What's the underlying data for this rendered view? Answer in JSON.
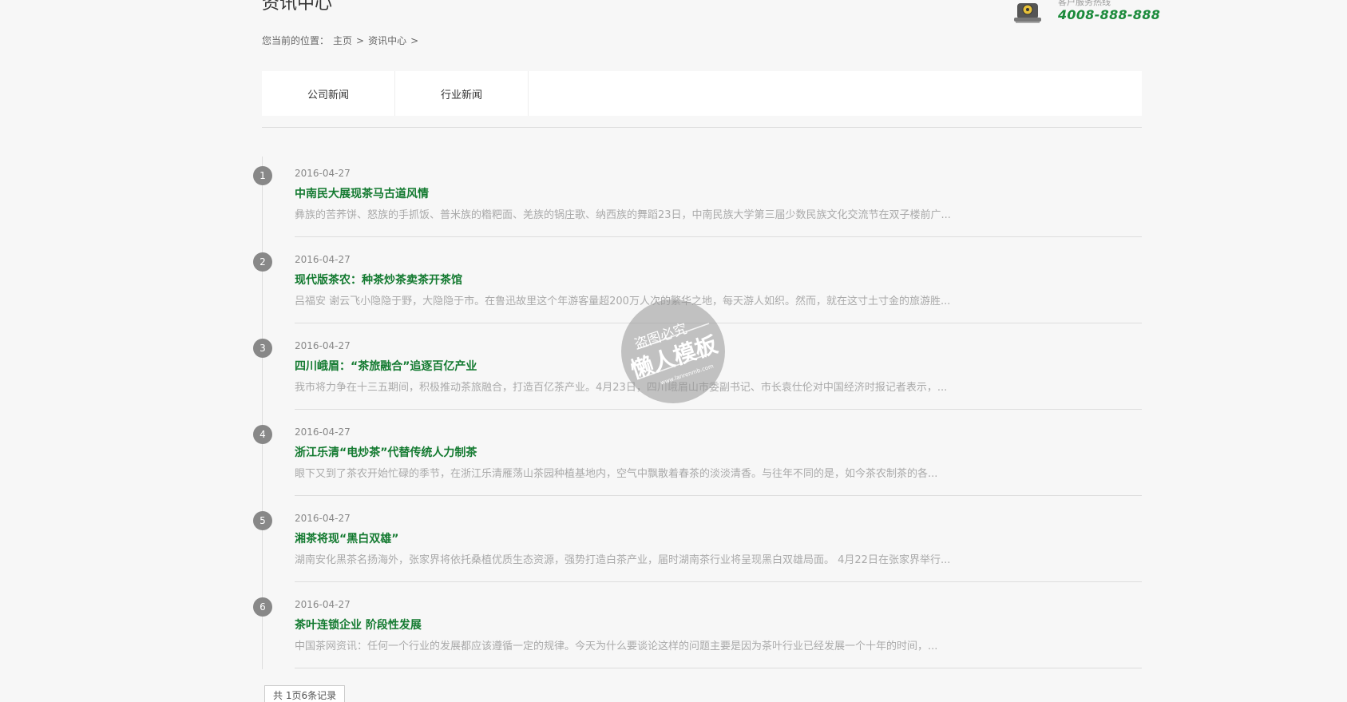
{
  "header": {
    "page_title": "资讯中心",
    "hotline_label": "客户服务热线",
    "hotline_number": "4008-888-888"
  },
  "breadcrumb": {
    "prefix": "您当前的位置：",
    "items": [
      "主页",
      "资讯中心"
    ],
    "separator": ">"
  },
  "tabs": [
    {
      "label": "公司新闻"
    },
    {
      "label": "行业新闻"
    }
  ],
  "news": [
    {
      "index": "1",
      "date": "2016-04-27",
      "title": "中南民大展现茶马古道风情",
      "summary": "彝族的苦荞饼、怒族的手抓饭、普米族的糌粑面、羌族的锅庄歌、纳西族的舞蹈23日，中南民族大学第三届少数民族文化交流节在双子楼前广..."
    },
    {
      "index": "2",
      "date": "2016-04-27",
      "title": "现代版茶农：种茶炒茶卖茶开茶馆",
      "summary": "吕福安 谢云飞小隐隐于野，大隐隐于市。在鲁迅故里这个年游客量超200万人次的繁华之地，每天游人如织。然而，就在这寸土寸金的旅游胜..."
    },
    {
      "index": "3",
      "date": "2016-04-27",
      "title": "四川峨眉：“茶旅融合”追逐百亿产业",
      "summary": "我市将力争在十三五期间，积极推动茶旅融合，打造百亿茶产业。4月23日，四川峨眉山市委副书记、市长袁仕伦对中国经济时报记者表示，..."
    },
    {
      "index": "4",
      "date": "2016-04-27",
      "title": "浙江乐清“电炒茶”代替传统人力制茶",
      "summary": "眼下又到了茶农开始忙碌的季节，在浙江乐清雁荡山茶园种植基地内，空气中飘散着春茶的淡淡清香。与往年不同的是，如今茶农制茶的各..."
    },
    {
      "index": "5",
      "date": "2016-04-27",
      "title": "湘茶将现“黑白双雄”",
      "summary": "湖南安化黑茶名扬海外，张家界将依托桑植优质生态资源，强势打造白茶产业，届时湖南茶行业将呈现黑白双雄局面。 4月22日在张家界举行..."
    },
    {
      "index": "6",
      "date": "2016-04-27",
      "title": "茶叶连锁企业 阶段性发展",
      "summary": "中国茶网资讯：任何一个行业的发展都应该遵循一定的规律。今天为什么要谈论这样的问题主要是因为茶叶行业已经发展一个十年的时间，..."
    }
  ],
  "pager": {
    "text": "共 1页6条记录"
  },
  "watermark": {
    "top_text": "盗图必究",
    "main_text": "懒人模板",
    "url_text": "www.lanrenmb.com"
  },
  "colors": {
    "accent_green": "#137a30",
    "hotline_green": "#1a8a3a",
    "badge_gray": "#888888",
    "background": "#f7f7f7"
  }
}
